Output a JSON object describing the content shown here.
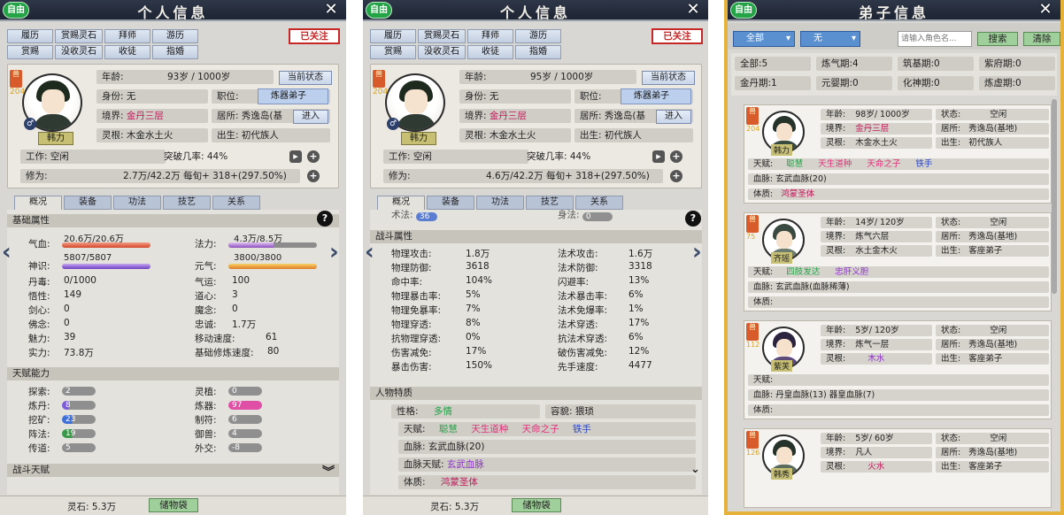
{
  "common": {
    "ziyou": "自由",
    "close": "✕",
    "lingshi": "灵石: 5.3万",
    "bag": "储物袋",
    "follow": "已关注",
    "help": "?"
  },
  "p1": {
    "title": "个人信息",
    "nav": [
      "履历",
      "赏赐灵石",
      "拜师",
      "游历",
      "赏赐",
      "没收灵石",
      "收徒",
      "指婚"
    ],
    "name": "韩力",
    "badge": "兽",
    "badge_num": "204",
    "age": "年龄:",
    "age_val": "93岁 / 1000岁",
    "status_btn": "当前状态",
    "identity": "身份: 无",
    "position_label": "职位:",
    "position_val": "炼器弟子",
    "realm_label": "境界:",
    "realm_val": "金丹三层",
    "residence": "居所: 秀逸岛(基",
    "enter": "进入",
    "root_label": "灵根:",
    "root_val": "木金水土火",
    "birth": "出生:  初代族人",
    "work": "工作: 空闲",
    "break_rate": "突破几率: 44%",
    "cultivation_label": "修为:",
    "cultivation_val": "2.7万/42.2万   每旬+  318+(297.50%)",
    "tabs": [
      "概况",
      "装备",
      "功法",
      "技艺",
      "关系"
    ],
    "sec_basic": "基础属性",
    "qixue": "气血:",
    "qixue_val": "20.6万/20.6万",
    "fali": "法力:",
    "fali_val": "4.3万/8.5万",
    "shenshi": "神识:",
    "shenshi_val": "5807/5807",
    "yuanqi": "元气:",
    "yuanqi_val": "3800/3800",
    "stats_left": [
      [
        "丹毒:",
        "0/1000"
      ],
      [
        "悟性:",
        "149"
      ],
      [
        "剑心:",
        "0"
      ],
      [
        "佛念:",
        "0"
      ],
      [
        "魅力:",
        "39"
      ],
      [
        "实力:",
        "73.8万"
      ]
    ],
    "stats_right": [
      [
        "气运:",
        "100"
      ],
      [
        "道心:",
        "3"
      ],
      [
        "魔念:",
        "0"
      ],
      [
        "忠诚:",
        "1.7万"
      ],
      [
        "移动速度:",
        "61"
      ],
      [
        "基础修炼速度:",
        "80"
      ]
    ],
    "sec_talent": "天赋能力",
    "talent_left": [
      [
        "探索:",
        "2"
      ],
      [
        "炼丹:",
        "8"
      ],
      [
        "挖矿:",
        "23"
      ],
      [
        "阵法:",
        "19"
      ],
      [
        "传道:",
        "5"
      ]
    ],
    "talent_right": [
      [
        "灵植:",
        "0"
      ],
      [
        "炼器:",
        "97"
      ],
      [
        "制符:",
        "6"
      ],
      [
        "御兽:",
        "4"
      ],
      [
        "外交:",
        "-8"
      ]
    ],
    "sec_battle": "战斗天赋"
  },
  "p2": {
    "title": "个人信息",
    "name": "韩力",
    "age_val": "95岁 / 1000岁",
    "cultivation_val": "4.6万/42.2万   每旬+  318+(297.50%)",
    "cut_left": "术法: ",
    "cut_left_val": "36",
    "cut_right": "身法: ",
    "cut_right_val": "0",
    "sec_battle_attr": "战斗属性",
    "battle_left": [
      [
        "物理攻击:",
        "1.8万"
      ],
      [
        "物理防御:",
        "3618"
      ],
      [
        "命中率:",
        "104%"
      ],
      [
        "物理暴击率:",
        "5%"
      ],
      [
        "物理免暴率:",
        "7%"
      ],
      [
        "物理穿透:",
        "8%"
      ],
      [
        "抗物理穿透:",
        "0%"
      ],
      [
        "伤害减免:",
        "17%"
      ],
      [
        "暴击伤害:",
        "150%"
      ]
    ],
    "battle_right": [
      [
        "法术攻击:",
        "1.6万"
      ],
      [
        "法术防御:",
        "3318"
      ],
      [
        "闪避率:",
        "13%"
      ],
      [
        "法术暴击率:",
        "6%"
      ],
      [
        "法术免爆率:",
        "1%"
      ],
      [
        "法术穿透:",
        "17%"
      ],
      [
        "抗法术穿透:",
        "6%"
      ],
      [
        "破伤害减免:",
        "12%"
      ],
      [
        "先手速度:",
        "4477"
      ]
    ],
    "sec_trait": "人物特质",
    "xingge": "性格:",
    "xingge_val": "多情",
    "rongmao": "容貌:  猥琐",
    "tianfu": "天赋:",
    "tianfu_vals": [
      "聪慧",
      "天生道种",
      "天命之子",
      "铁手"
    ],
    "xuemai": "血脉:  玄武血脉(20)",
    "xuemai_tf": "血脉天赋:",
    "xuemai_tf_val": "玄武血脉",
    "tizhi": "体质:",
    "tizhi_val": "鸿蒙圣体"
  },
  "p3": {
    "title": "弟子信息",
    "filter1": "全部",
    "filter2": "无",
    "search_placeholder": "请输入角色名...",
    "search": "搜索",
    "clear": "清除",
    "counts": [
      "全部:5",
      "炼气期:4",
      "筑基期:0",
      "紫府期:0",
      "金丹期:1",
      "元婴期:0",
      "化神期:0",
      "炼虚期:0"
    ],
    "disciples": [
      {
        "name": "韩力",
        "num": "204",
        "age": "98岁/ 1000岁",
        "state": "空闲",
        "realm": "金丹三层",
        "res": "秀逸岛(基地)",
        "root": "木金水土火",
        "birth": "初代族人",
        "tf": [
          "聪慧",
          "天生道种",
          "天命之子",
          "铁手"
        ],
        "xm": "血脉:  玄武血脉(20)",
        "tz": "鸿蒙圣体"
      },
      {
        "name": "齐瑶",
        "num": "75",
        "age": "14岁/ 120岁",
        "state": "空闲",
        "realm": "炼气六层",
        "res": "秀逸岛(基地)",
        "root": "水土金木火",
        "birth": "客座弟子",
        "tf": [
          "四肢发达",
          "忠肝义胆"
        ],
        "xm": "血脉:  玄武血脉(血脉稀薄)",
        "tz": ""
      },
      {
        "name": "紫芙",
        "num": "112",
        "age": "5岁/ 120岁",
        "state": "空闲",
        "realm": "炼气一层",
        "res": "秀逸岛(基地)",
        "root": "木水",
        "birth": "客座弟子",
        "tf": [],
        "xm": "血脉:  丹皇血脉(13)     器皇血脉(7)",
        "tz": ""
      },
      {
        "name": "韩秀",
        "num": "126",
        "age": "5岁/ 60岁",
        "state": "空闲",
        "realm": "凡人",
        "res": "秀逸岛(基地)",
        "root": "火水",
        "birth": "客座弟子",
        "tf": [],
        "xm": "",
        "tz": ""
      }
    ],
    "labels": {
      "age": "年龄:",
      "state": "状态:",
      "realm": "境界:",
      "res": "居所:",
      "root": "灵根:",
      "birth": "出生:",
      "tf": "天赋:",
      "tz": "体质:"
    }
  }
}
